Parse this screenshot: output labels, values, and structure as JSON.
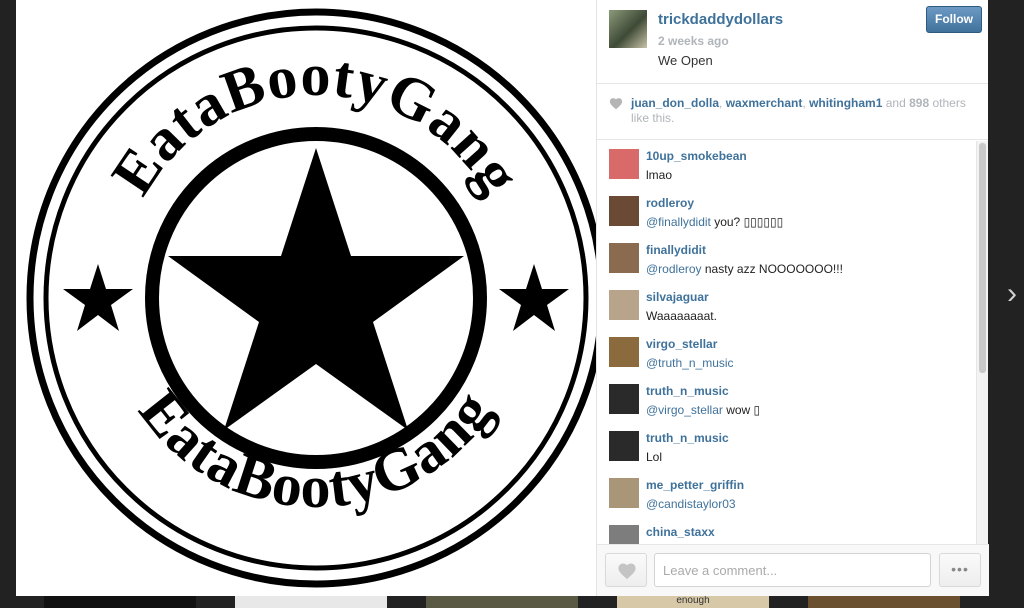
{
  "post": {
    "username": "trickdaddydollars",
    "time": "2 weeks ago",
    "caption": "We Open",
    "follow_label": "Follow"
  },
  "image": {
    "text_top": "EataBootyGang",
    "text_bottom": "EataBootyGang"
  },
  "likes": {
    "users": [
      "juan_don_dolla",
      "waxmerchant",
      "whitingham1"
    ],
    "sep1": ", ",
    "sep2": ", ",
    "and_text": " and ",
    "count": "898",
    "suffix": " others like this."
  },
  "comments": [
    {
      "user": "10up_smokebean",
      "mention": "",
      "text": "lmao",
      "avatar_color": "#d96a6a"
    },
    {
      "user": "rodleroy",
      "mention": "@finallydidit",
      "text": " you? ▯▯▯▯▯▯",
      "avatar_color": "#6b4a35"
    },
    {
      "user": "finallydidit",
      "mention": "@rodleroy",
      "text": " nasty azz NOOOOOOO!!!",
      "avatar_color": "#8a6b4f"
    },
    {
      "user": "silvajaguar",
      "mention": "",
      "text": "Waaaaaaaat.",
      "avatar_color": "#b7a48a"
    },
    {
      "user": "virgo_stellar",
      "mention": "@truth_n_music",
      "text": "",
      "avatar_color": "#8b6a3e"
    },
    {
      "user": "truth_n_music",
      "mention": "@virgo_stellar",
      "text": " wow ▯",
      "avatar_color": "#2a2a2a"
    },
    {
      "user": "truth_n_music",
      "mention": "",
      "text": "Lol",
      "avatar_color": "#2a2a2a"
    },
    {
      "user": "me_petter_griffin",
      "mention": "@candistaylor03",
      "text": "",
      "avatar_color": "#a99679"
    },
    {
      "user": "china_staxx",
      "mention": "",
      "text": "",
      "avatar_color": "#7d7d7d"
    }
  ],
  "comment_input": {
    "placeholder": "Leave a comment..."
  },
  "more_label": "•••",
  "background": {
    "visible_text": "enough"
  },
  "colors": {
    "link": "#3f729b",
    "follow": "#3f729b",
    "muted": "#b0b5b9"
  },
  "icons": {
    "heart": "heart-icon",
    "next": "chevron-right-icon",
    "more": "ellipsis-icon"
  }
}
